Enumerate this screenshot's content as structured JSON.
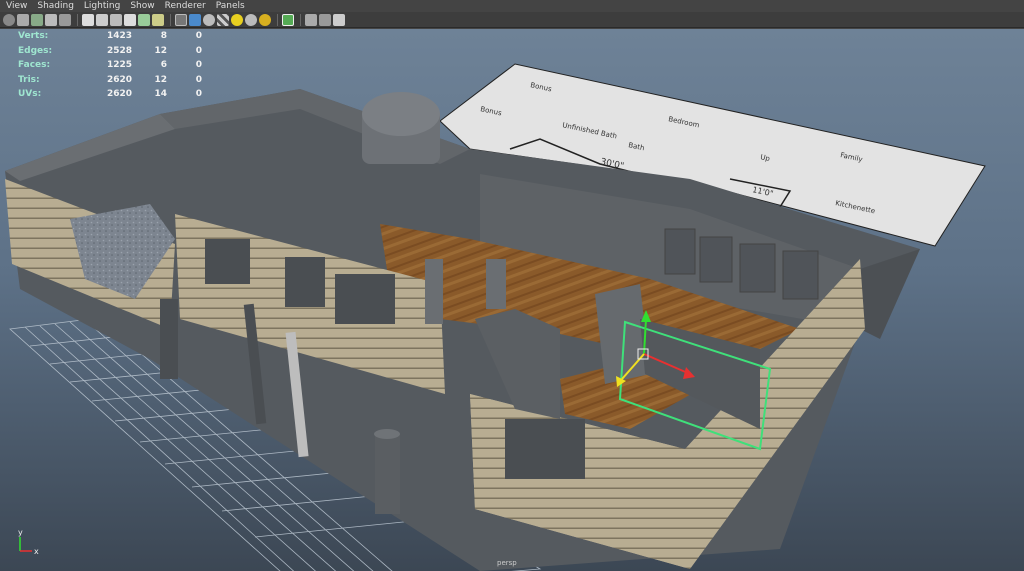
{
  "menu": [
    "View",
    "Shading",
    "Lighting",
    "Show",
    "Renderer",
    "Panels"
  ],
  "hud": {
    "rows": [
      {
        "label": "Verts:",
        "total": "1423",
        "selected": "8",
        "components": "0"
      },
      {
        "label": "Edges:",
        "total": "2528",
        "selected": "12",
        "components": "0"
      },
      {
        "label": "Faces:",
        "total": "1225",
        "selected": "6",
        "components": "0"
      },
      {
        "label": "Tris:",
        "total": "2620",
        "selected": "12",
        "components": "0"
      },
      {
        "label": "UVs:",
        "total": "2620",
        "selected": "14",
        "components": "0"
      }
    ]
  },
  "floorplan": {
    "labels": [
      "Bonus",
      "Bonus",
      "Unfinished Bath",
      "Bath",
      "Bedroom",
      "Up",
      "Family",
      "Kitchenette",
      "30'0\"",
      "11'0\""
    ]
  },
  "viewport": {
    "camera": "persp",
    "axis": {
      "x": "x",
      "y": "y"
    },
    "colors": {
      "manip_x": "#e83030",
      "manip_y": "#30e030",
      "manip_z": "#f0e020",
      "selection": "#3fe07a"
    }
  },
  "toolbar": {
    "icons": [
      "camera-select-icon",
      "camera-attr-icon",
      "bookmark-icon",
      "image-plane-icon",
      "grid-toggle-icon",
      "film-gate-icon",
      "resolution-gate-icon",
      "gate-mask-icon",
      "field-chart-icon",
      "safe-action-icon",
      "safe-title-icon",
      "wireframe-icon",
      "smooth-shade-icon",
      "wireframe-on-shaded-icon",
      "textured-icon",
      "default-light-icon",
      "all-lights-icon",
      "shadows-icon",
      "isolate-select-icon",
      "xray-icon",
      "xray-joints-icon",
      "backface-culling-icon"
    ]
  }
}
